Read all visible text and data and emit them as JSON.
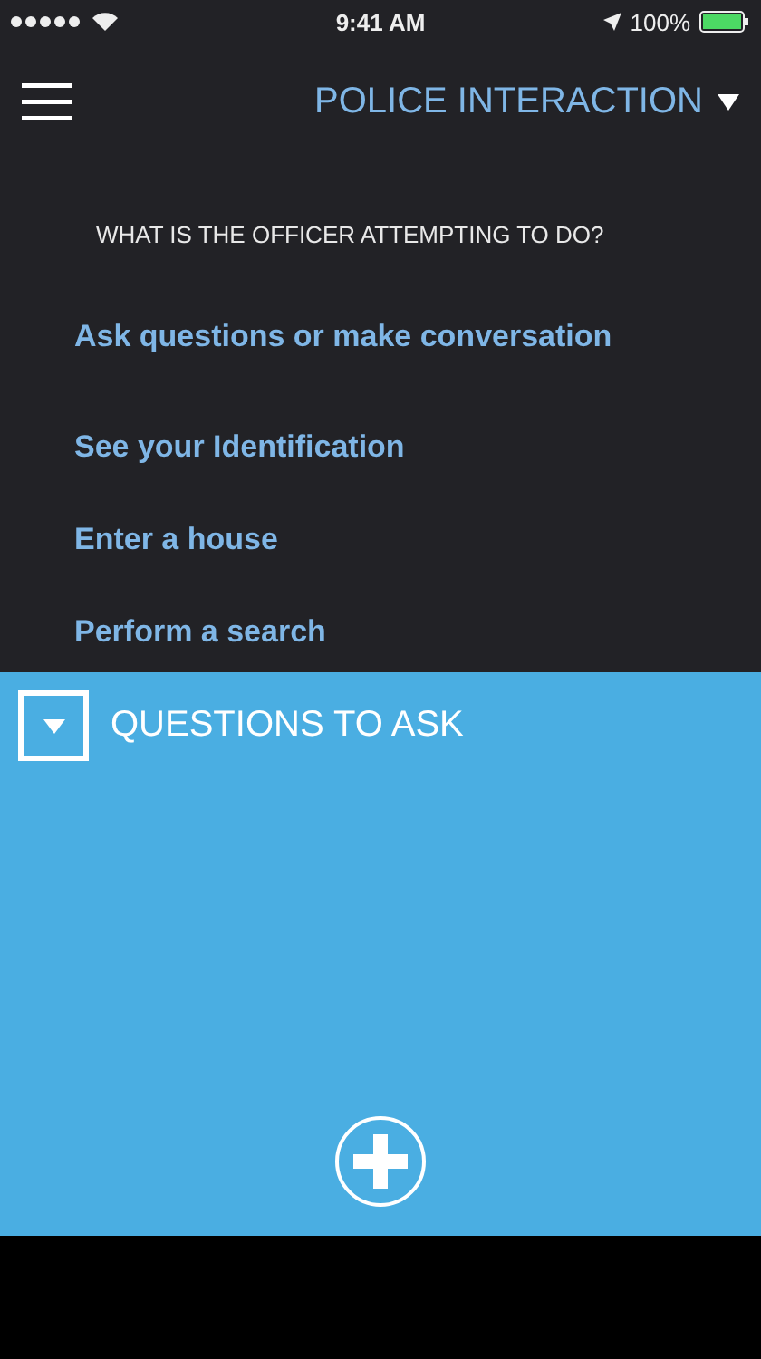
{
  "status_bar": {
    "time": "9:41 AM",
    "battery": "100%"
  },
  "nav": {
    "title": "POLICE INTERACTION"
  },
  "question": "WHAT IS THE OFFICER ATTEMPTING TO DO?",
  "options": [
    "Ask questions or make conversation",
    "See your Identification",
    "Enter a house",
    "Perform a search"
  ],
  "panel": {
    "title": "QUESTIONS TO ASK",
    "expanded": false
  }
}
